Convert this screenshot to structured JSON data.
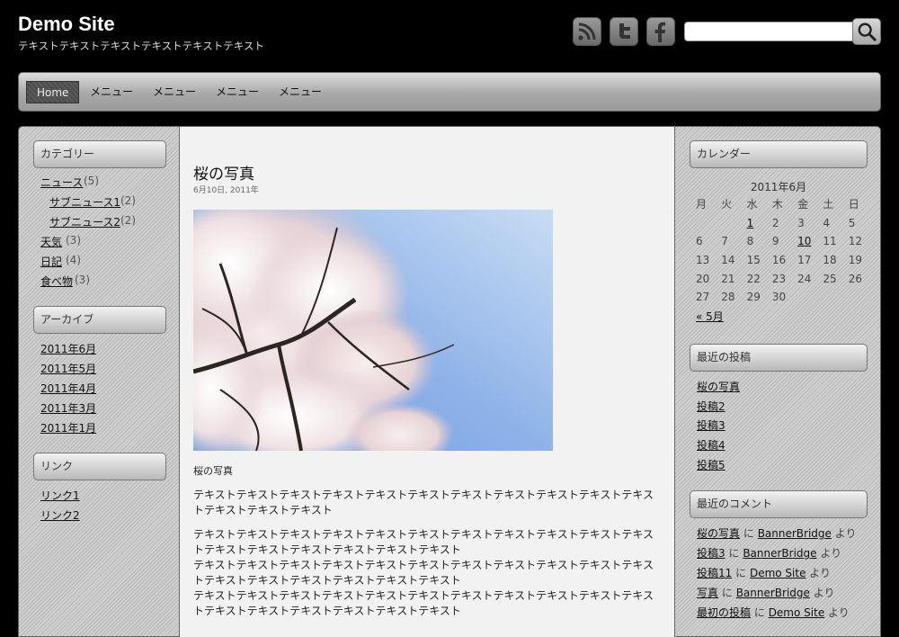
{
  "site": {
    "title": "Demo Site",
    "tagline": "テキストテキストテキストテキストテキストテキスト"
  },
  "header": {
    "social": [
      "rss-icon",
      "twitter-icon",
      "facebook-icon"
    ],
    "search_value": ""
  },
  "nav": {
    "items": [
      "Home",
      "メニュー",
      "メニュー",
      "メニュー",
      "メニュー"
    ]
  },
  "left_sidebar": {
    "categories": {
      "title": "カテゴリー",
      "items": [
        {
          "label": "ニュース",
          "count": "(5)"
        },
        {
          "label": "サブニュース1",
          "count": "(2)"
        },
        {
          "label": "サブニュース2",
          "count": "(2)"
        },
        {
          "label": "天気",
          "count": "(3)"
        },
        {
          "label": "日記",
          "count": "(4)"
        },
        {
          "label": "食べ物",
          "count": "(3)"
        }
      ]
    },
    "archives": {
      "title": "アーカイブ",
      "items": [
        "2011年6月",
        "2011年5月",
        "2011年4月",
        "2011年3月",
        "2011年1月"
      ]
    },
    "links": {
      "title": "リンク",
      "items": [
        "リンク1",
        "リンク2"
      ]
    }
  },
  "post": {
    "title": "桜の写真",
    "date": "6月10日, 2011年",
    "caption": "桜の写真",
    "paragraphs": [
      "テキストテキストテキストテキストテキストテキストテキストテキストテキストテキストテキストテキストテキストテキスト",
      "テキストテキストテキストテキストテキストテキストテキストテキストテキストテキストテキストテキストテキストテキストテキストテキストテキスト\nテキストテキストテキストテキストテキストテキストテキストテキストテキストテキストテキストテキストテキストテキストテキストテキストテキスト\nテキストテキストテキストテキストテキストテキストテキストテキストテキストテキストテキストテキストテキストテキストテキストテキストテキスト"
    ]
  },
  "right_sidebar": {
    "calendar": {
      "title": "カレンダー",
      "caption": "2011年6月",
      "weekdays": [
        "月",
        "火",
        "水",
        "木",
        "金",
        "土",
        "日"
      ],
      "weeks": [
        [
          "",
          "",
          "1",
          "2",
          "3",
          "4",
          "5"
        ],
        [
          "6",
          "7",
          "8",
          "9",
          "10",
          "11",
          "12"
        ],
        [
          "13",
          "14",
          "15",
          "16",
          "17",
          "18",
          "19"
        ],
        [
          "20",
          "21",
          "22",
          "23",
          "24",
          "25",
          "26"
        ],
        [
          "27",
          "28",
          "29",
          "30",
          "",
          "",
          ""
        ]
      ],
      "linked_days": [
        "1",
        "10"
      ],
      "prev_label": "« 5月"
    },
    "recent_posts": {
      "title": "最近の投稿",
      "items": [
        "桜の写真",
        "投稿2",
        "投稿3",
        "投稿4",
        "投稿5"
      ]
    },
    "recent_comments": {
      "title": "最近のコメント",
      "items": [
        {
          "post": "桜の写真",
          "on": "に",
          "author": "BannerBridge",
          "suffix": "より"
        },
        {
          "post": "投稿3",
          "on": "に",
          "author": "BannerBridge",
          "suffix": "より"
        },
        {
          "post": "投稿11",
          "on": "に",
          "author": "Demo Site",
          "suffix": "より"
        },
        {
          "post": "写真",
          "on": "に",
          "author": "BannerBridge",
          "suffix": "より"
        },
        {
          "post": "最初の投稿",
          "on": "に",
          "author": "Demo Site",
          "suffix": "より"
        }
      ]
    }
  }
}
